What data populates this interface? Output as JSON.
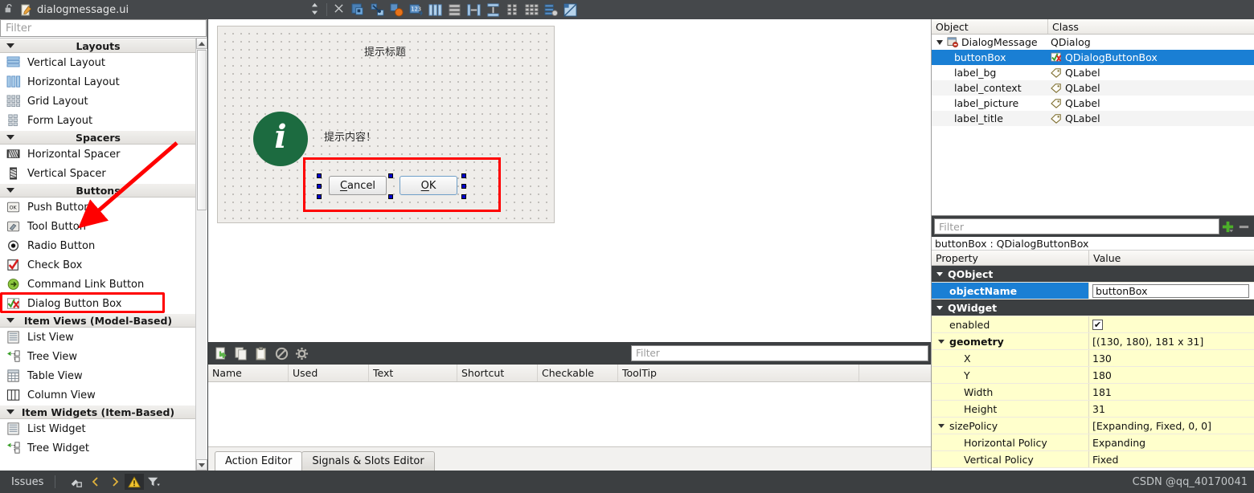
{
  "titlebar": {
    "filename": "dialogmessage.ui",
    "lock_icon": "unlocked-padlock-icon",
    "file_icon": "ui-file-icon",
    "updown_icon": "split-updown-icon",
    "close_icon": "close-icon",
    "tools": [
      {
        "name": "adjust-size-icon"
      },
      {
        "name": "break-layout-icon"
      },
      {
        "name": "edit-signals-slots-icon"
      },
      {
        "name": "edit-buddies-icon"
      },
      {
        "name": "layout-horizontally-icon"
      },
      {
        "name": "layout-vertically-icon"
      },
      {
        "name": "layout-in-splitter-horizontal-icon"
      },
      {
        "name": "layout-in-splitter-vertical-icon"
      },
      {
        "name": "layout-form-icon"
      },
      {
        "name": "layout-grid-icon"
      },
      {
        "name": "layout-break-icon"
      },
      {
        "name": "preview-icon"
      }
    ]
  },
  "widgetbox": {
    "filter_placeholder": "Filter",
    "sections": [
      {
        "label": "Layouts",
        "items": [
          {
            "label": "Vertical Layout",
            "icon": "vertical-layout-icon"
          },
          {
            "label": "Horizontal Layout",
            "icon": "horizontal-layout-icon"
          },
          {
            "label": "Grid Layout",
            "icon": "grid-layout-icon"
          },
          {
            "label": "Form Layout",
            "icon": "form-layout-icon"
          }
        ]
      },
      {
        "label": "Spacers",
        "items": [
          {
            "label": "Horizontal Spacer",
            "icon": "horizontal-spacer-icon"
          },
          {
            "label": "Vertical Spacer",
            "icon": "vertical-spacer-icon"
          }
        ]
      },
      {
        "label": "Buttons",
        "items": [
          {
            "label": "Push Button",
            "icon": "push-button-icon"
          },
          {
            "label": "Tool Button",
            "icon": "tool-button-icon"
          },
          {
            "label": "Radio Button",
            "icon": "radio-button-icon"
          },
          {
            "label": "Check Box",
            "icon": "check-box-icon"
          },
          {
            "label": "Command Link Button",
            "icon": "command-link-button-icon"
          },
          {
            "label": "Dialog Button Box",
            "icon": "dialog-button-box-icon",
            "highlighted": true
          }
        ]
      },
      {
        "label": "Item Views (Model-Based)",
        "items": [
          {
            "label": "List View",
            "icon": "list-view-icon"
          },
          {
            "label": "Tree View",
            "icon": "tree-view-icon"
          },
          {
            "label": "Table View",
            "icon": "table-view-icon"
          },
          {
            "label": "Column View",
            "icon": "column-view-icon"
          }
        ]
      },
      {
        "label": "Item Widgets (Item-Based)",
        "items": [
          {
            "label": "List Widget",
            "icon": "list-widget-icon"
          },
          {
            "label": "Tree Widget",
            "icon": "tree-widget-icon"
          }
        ]
      }
    ]
  },
  "canvas": {
    "dialog_title_label": "提示标题",
    "dialog_context_label": "提示内容！",
    "info_glyph": "i",
    "info_color": "#1c6b40",
    "buttons": [
      {
        "label": "Cancel",
        "mnemonic": "C"
      },
      {
        "label": "OK",
        "mnemonic": "O"
      }
    ],
    "annotation_color": "#ff0000"
  },
  "action_editor": {
    "filter_placeholder": "Filter",
    "toolbar": [
      {
        "name": "new-action-icon"
      },
      {
        "name": "copy-icon"
      },
      {
        "name": "paste-icon"
      },
      {
        "name": "delete-icon"
      },
      {
        "name": "configure-icon"
      }
    ],
    "columns": [
      "Name",
      "Used",
      "Text",
      "Shortcut",
      "Checkable",
      "ToolTip"
    ],
    "rows": []
  },
  "bottom_tabs": [
    {
      "label": "Action Editor",
      "active": true
    },
    {
      "label": "Signals & Slots Editor",
      "active": false
    }
  ],
  "object_inspector": {
    "columns": [
      "Object",
      "Class"
    ],
    "rows": [
      {
        "object": "DialogMessage",
        "class": "QDialog",
        "indent": 0,
        "expander": true,
        "icon": "qdialog-icon",
        "selected": false
      },
      {
        "object": "buttonBox",
        "class": "QDialogButtonBox",
        "indent": 1,
        "icon": "dialog-button-box-icon",
        "selected": true
      },
      {
        "object": "label_bg",
        "class": "QLabel",
        "indent": 1,
        "icon": "qlabel-icon",
        "selected": false
      },
      {
        "object": "label_context",
        "class": "QLabel",
        "indent": 1,
        "icon": "qlabel-icon",
        "selected": false
      },
      {
        "object": "label_picture",
        "class": "QLabel",
        "indent": 1,
        "icon": "qlabel-icon",
        "selected": false
      },
      {
        "object": "label_title",
        "class": "QLabel",
        "indent": 1,
        "icon": "qlabel-icon",
        "selected": false
      }
    ]
  },
  "property_editor": {
    "filter_placeholder": "Filter",
    "add_icon": "plus-icon",
    "remove_icon": "minus-icon",
    "object_line": "buttonBox : QDialogButtonBox",
    "columns": [
      "Property",
      "Value"
    ],
    "rows": [
      {
        "type": "group",
        "name": "QObject",
        "value": ""
      },
      {
        "type": "selected",
        "name": "objectName",
        "value": "buttonBox",
        "editable": true,
        "indent": 1
      },
      {
        "type": "group",
        "name": "QWidget",
        "value": ""
      },
      {
        "type": "yellow",
        "name": "enabled",
        "value": "",
        "checkbox": true,
        "checked": true,
        "indent": 1
      },
      {
        "type": "yellow",
        "name": "geometry",
        "value": "[(130, 180), 181 x 31]",
        "bold": true,
        "expander": true,
        "indent": 0
      },
      {
        "type": "yellow",
        "name": "X",
        "value": "130",
        "indent": 2
      },
      {
        "type": "yellow",
        "name": "Y",
        "value": "180",
        "indent": 2
      },
      {
        "type": "yellow",
        "name": "Width",
        "value": "181",
        "indent": 2
      },
      {
        "type": "yellow",
        "name": "Height",
        "value": "31",
        "indent": 2
      },
      {
        "type": "yellow",
        "name": "sizePolicy",
        "value": "[Expanding, Fixed, 0, 0]",
        "expander": true,
        "indent": 0
      },
      {
        "type": "yellow",
        "name": "Horizontal Policy",
        "value": "Expanding",
        "indent": 2
      },
      {
        "type": "yellow",
        "name": "Vertical Policy",
        "value": "Fixed",
        "indent": 2
      }
    ]
  },
  "statusbar": {
    "issues_label": "Issues",
    "icons": [
      {
        "name": "filter-clear-icon"
      },
      {
        "name": "previous-issue-icon"
      },
      {
        "name": "next-issue-icon"
      },
      {
        "name": "warning-icon"
      },
      {
        "name": "filter-dropdown-icon"
      }
    ],
    "watermark": "CSDN @qq_40170041"
  }
}
